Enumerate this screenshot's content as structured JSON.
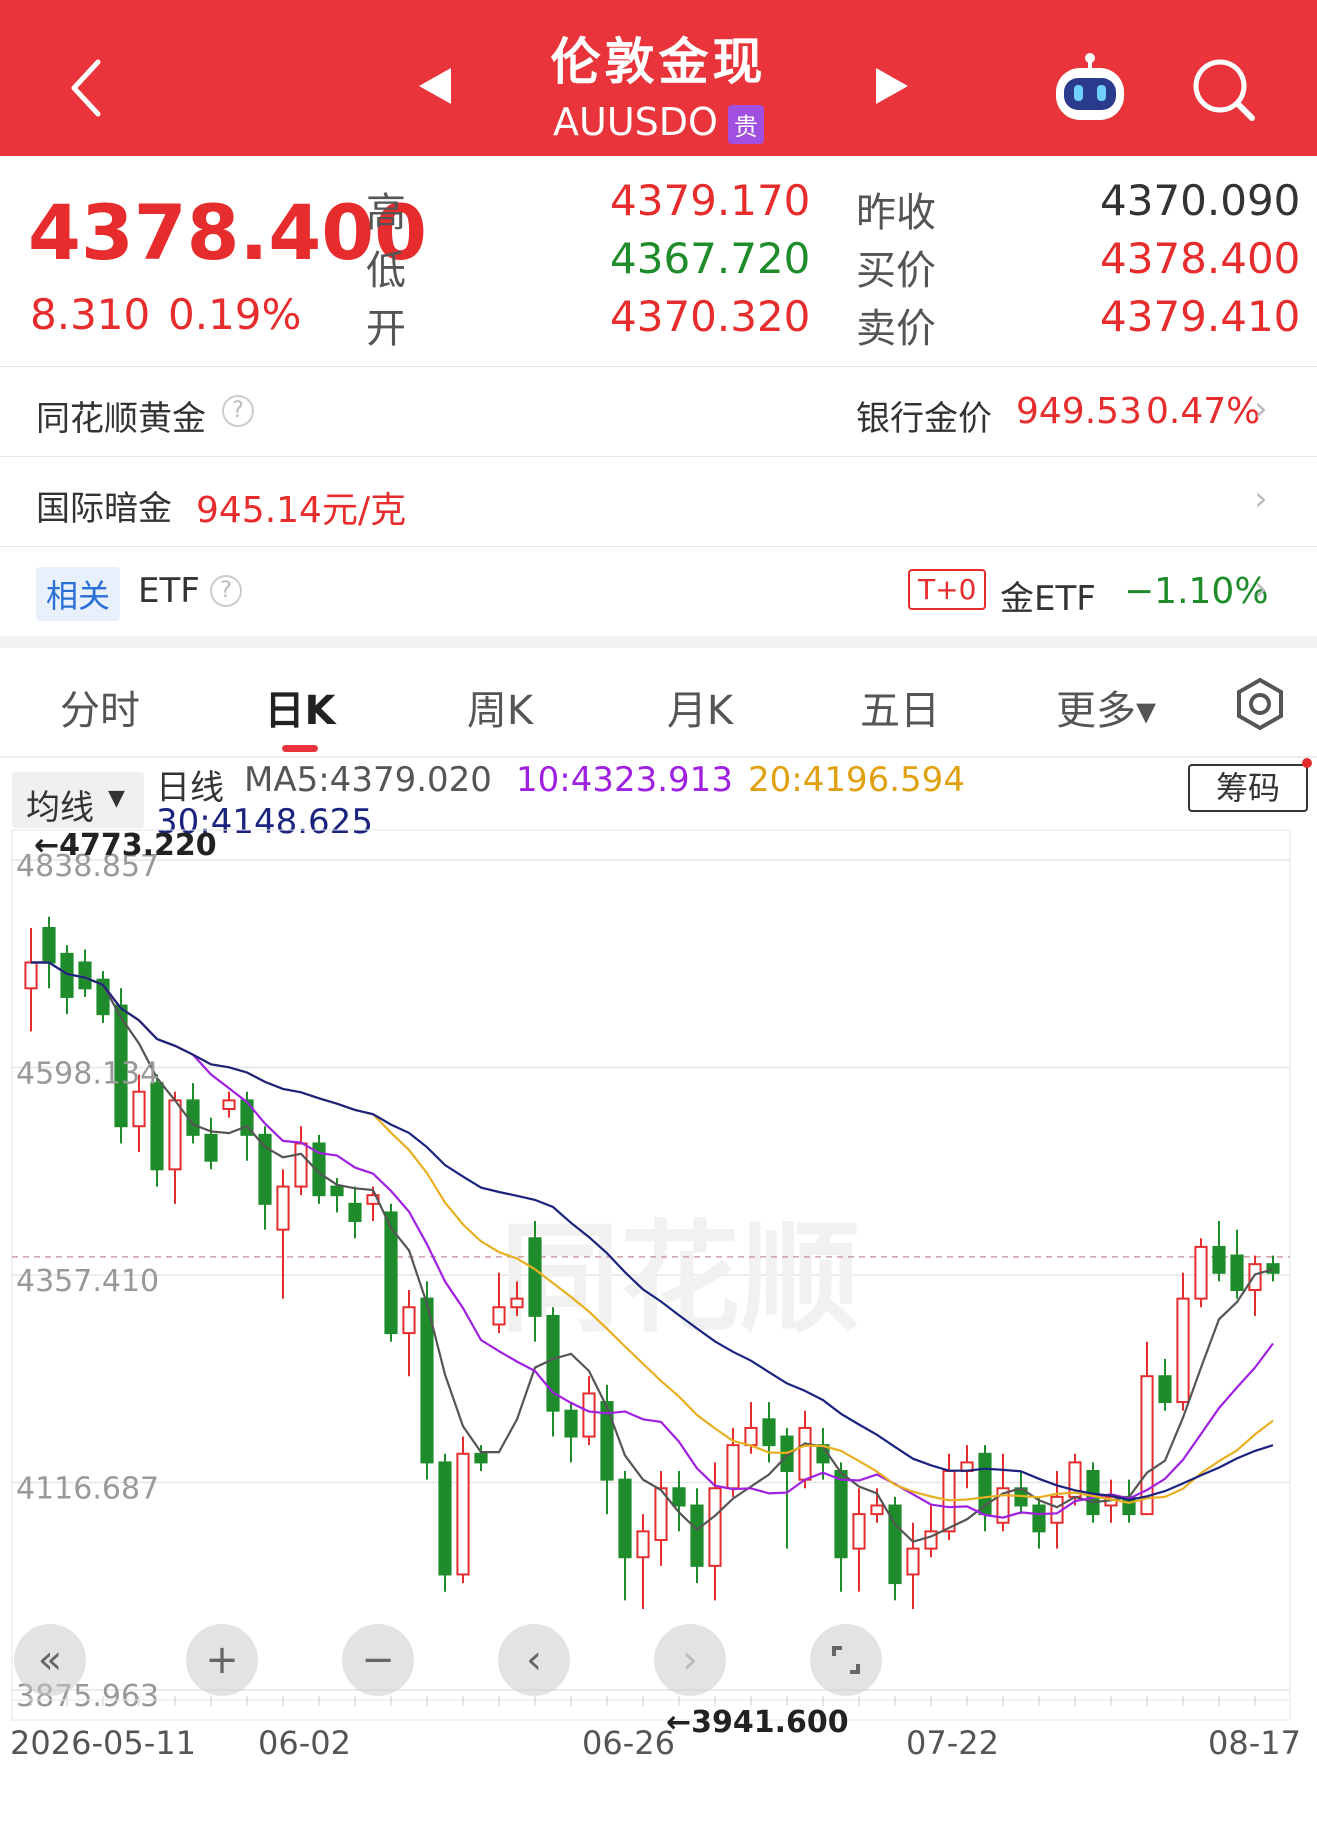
{
  "header": {
    "title": "伦敦金现",
    "code": "AUUSDO",
    "code_tag": "贵"
  },
  "quote": {
    "price": "4378.400",
    "change": "8.310",
    "change_pct": "0.19%",
    "labels": {
      "high": "高",
      "low": "低",
      "open": "开",
      "prev_close": "昨收",
      "bid": "买价",
      "ask": "卖价"
    },
    "high": "4379.170",
    "low": "4367.720",
    "open": "4370.320",
    "prev_close": "4370.090",
    "bid": "4378.400",
    "ask": "4379.410"
  },
  "rows": {
    "ths_gold": "同花顺黄金",
    "bank_gold_label": "银行金价",
    "bank_gold_value": "949.53",
    "bank_gold_pct": "0.47%",
    "intl_dark_label": "国际暗金",
    "intl_dark_value": "945.14元/克",
    "related_tag": "相关",
    "related_label": "ETF",
    "t0_tag": "T+0",
    "gold_etf_label": "金ETF",
    "gold_etf_pct": "−1.10%"
  },
  "tabs": [
    {
      "label": "分时"
    },
    {
      "label": "日K"
    },
    {
      "label": "周K"
    },
    {
      "label": "月K"
    },
    {
      "label": "五日"
    },
    {
      "label": "更多▾"
    }
  ],
  "indicator": {
    "ma_dropdown": "均线",
    "line_label": "日线",
    "ma5": "MA5:4379.020",
    "ma10": "10:4323.913",
    "ma20": "20:4196.594",
    "ma30": "30:4148.625",
    "chip_button": "筹码"
  },
  "colors": {
    "brand": "#e8343a",
    "up": "#e62c2c",
    "down": "#1e8c2a",
    "ma5": "#555555",
    "ma10": "#a020e0",
    "ma20": "#e8b020",
    "ma30": "#1a237e"
  },
  "chart_data": {
    "type": "candlestick",
    "y_ticks": [
      "4838.857",
      "4598.134",
      "4357.410",
      "4116.687",
      "3875.963"
    ],
    "x_ticks": [
      "2026-05-11",
      "06-02",
      "06-26",
      "07-22",
      "08-17"
    ],
    "ylim": [
      3875.963,
      4838.857
    ],
    "max_label": "←4773.220",
    "min_label": "←3941.600",
    "current_price": 4378.4,
    "candles": [
      [
        4690,
        4720,
        4760,
        4640
      ],
      [
        4760,
        4720,
        4773,
        4690
      ],
      [
        4730,
        4680,
        4740,
        4660
      ],
      [
        4720,
        4690,
        4735,
        4680
      ],
      [
        4700,
        4660,
        4710,
        4650
      ],
      [
        4670,
        4530,
        4690,
        4510
      ],
      [
        4530,
        4570,
        4590,
        4500
      ],
      [
        4580,
        4480,
        4590,
        4460
      ],
      [
        4480,
        4560,
        4570,
        4440
      ],
      [
        4560,
        4520,
        4580,
        4510
      ],
      [
        4520,
        4490,
        4540,
        4480
      ],
      [
        4550,
        4560,
        4570,
        4540
      ],
      [
        4560,
        4520,
        4570,
        4490
      ],
      [
        4520,
        4440,
        4530,
        4410
      ],
      [
        4410,
        4460,
        4480,
        4330
      ],
      [
        4460,
        4510,
        4530,
        4450
      ],
      [
        4510,
        4450,
        4520,
        4440
      ],
      [
        4460,
        4450,
        4470,
        4430
      ],
      [
        4440,
        4420,
        4460,
        4400
      ],
      [
        4440,
        4450,
        4460,
        4420
      ],
      [
        4430,
        4290,
        4440,
        4280
      ],
      [
        4290,
        4320,
        4340,
        4240
      ],
      [
        4330,
        4140,
        4350,
        4120
      ],
      [
        4140,
        4010,
        4150,
        3990
      ],
      [
        4010,
        4150,
        4170,
        4000
      ],
      [
        4150,
        4140,
        4160,
        4130
      ],
      [
        4300,
        4320,
        4360,
        4290
      ],
      [
        4320,
        4330,
        4350,
        4310
      ],
      [
        4400,
        4310,
        4420,
        4280
      ],
      [
        4310,
        4200,
        4320,
        4170
      ],
      [
        4200,
        4170,
        4210,
        4140
      ],
      [
        4170,
        4220,
        4240,
        4160
      ],
      [
        4210,
        4120,
        4230,
        4080
      ],
      [
        4120,
        4030,
        4130,
        3980
      ],
      [
        4030,
        4060,
        4080,
        3970
      ],
      [
        4050,
        4110,
        4130,
        4020
      ],
      [
        4110,
        4090,
        4130,
        4060
      ],
      [
        4090,
        4020,
        4110,
        4000
      ],
      [
        4020,
        4110,
        4140,
        3980
      ],
      [
        4110,
        4160,
        4180,
        4100
      ],
      [
        4160,
        4180,
        4210,
        4150
      ],
      [
        4190,
        4160,
        4210,
        4140
      ],
      [
        4170,
        4130,
        4180,
        4040
      ],
      [
        4120,
        4180,
        4200,
        4110
      ],
      [
        4160,
        4140,
        4180,
        4120
      ],
      [
        4130,
        4030,
        4140,
        3990
      ],
      [
        4040,
        4080,
        4110,
        3990
      ],
      [
        4080,
        4090,
        4110,
        4070
      ],
      [
        4090,
        4000,
        4100,
        3980
      ],
      [
        4010,
        4040,
        4070,
        3970
      ],
      [
        4040,
        4060,
        4090,
        4030
      ],
      [
        4060,
        4130,
        4150,
        4050
      ],
      [
        4130,
        4140,
        4160,
        4110
      ],
      [
        4150,
        4080,
        4160,
        4060
      ],
      [
        4070,
        4110,
        4150,
        4060
      ],
      [
        4110,
        4090,
        4130,
        4080
      ],
      [
        4090,
        4060,
        4100,
        4040
      ],
      [
        4070,
        4100,
        4130,
        4040
      ],
      [
        4100,
        4140,
        4150,
        4090
      ],
      [
        4130,
        4080,
        4140,
        4070
      ],
      [
        4090,
        4100,
        4120,
        4070
      ],
      [
        4100,
        4080,
        4120,
        4070
      ],
      [
        4080,
        4240,
        4280,
        4080
      ],
      [
        4240,
        4210,
        4260,
        4200
      ],
      [
        4210,
        4330,
        4360,
        4200
      ],
      [
        4330,
        4390,
        4400,
        4320
      ],
      [
        4390,
        4360,
        4420,
        4350
      ],
      [
        4380,
        4340,
        4410,
        4330
      ],
      [
        4340,
        4370,
        4380,
        4310
      ],
      [
        4370,
        4360,
        4380,
        4350
      ]
    ]
  }
}
